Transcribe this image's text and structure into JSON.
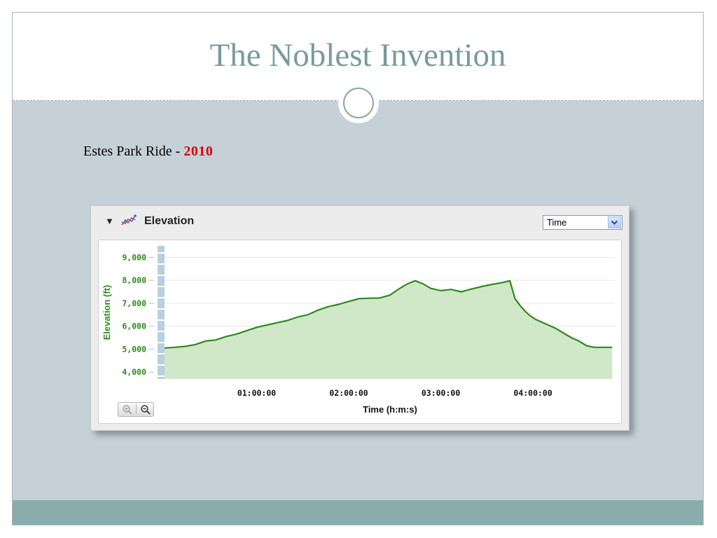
{
  "slide": {
    "title": "The Noblest Invention",
    "subtitle_prefix": "Estes Park Ride - ",
    "subtitle_year": "2010"
  },
  "widget": {
    "title": "Elevation",
    "select_value": "Time",
    "icons": [
      "collapse-triangle-icon",
      "elevation-chart-icon",
      "dropdown-chevron-icon",
      "zoom-in-icon",
      "zoom-out-icon"
    ]
  },
  "colors": {
    "title": "#7a9a9c",
    "slide_body": "#c5d1d7",
    "footer": "#8aacac",
    "year": "#d9000d",
    "line": "#2e8b1e",
    "fill": "#d0e8c7",
    "axis_text": "#2e8b1e"
  },
  "chart_data": {
    "type": "area",
    "xlabel": "Time (h:m:s)",
    "ylabel": "Elevation (ft)",
    "xlim": [
      0,
      17600
    ],
    "ylim": [
      3700,
      9500
    ],
    "y_ticks": [
      4000,
      5000,
      6000,
      7000,
      8000,
      9000
    ],
    "y_tick_labels": [
      "4,000",
      "5,000",
      "6,000",
      "7,000",
      "8,000",
      "9,000"
    ],
    "x_ticks": [
      3600,
      7200,
      10800,
      14400
    ],
    "x_tick_labels": [
      "01:00:00",
      "02:00:00",
      "03:00:00",
      "04:00:00"
    ],
    "grid": "horizontal",
    "series": [
      {
        "x": [
          0,
          400,
          800,
          1200,
          1600,
          2000,
          2400,
          2800,
          3200,
          3600,
          4000,
          4400,
          4800,
          5200,
          5600,
          6000,
          6400,
          6800,
          7200,
          7600,
          8000,
          8400,
          8800,
          9000,
          9200,
          9500,
          9800,
          10100,
          10400,
          10800,
          11200,
          11600,
          12000,
          12400,
          12800,
          13200,
          13500,
          13700,
          13900,
          14100,
          14300,
          14500,
          14700,
          15000,
          15300,
          15600,
          15900,
          16200,
          16500,
          16800,
          17100,
          17500
        ],
        "y": [
          5050,
          5080,
          5120,
          5200,
          5350,
          5400,
          5550,
          5650,
          5800,
          5950,
          6050,
          6150,
          6250,
          6400,
          6500,
          6700,
          6850,
          6950,
          7080,
          7200,
          7220,
          7230,
          7350,
          7500,
          7650,
          7850,
          7980,
          7850,
          7650,
          7550,
          7600,
          7500,
          7620,
          7730,
          7820,
          7900,
          7980,
          7200,
          6900,
          6650,
          6450,
          6300,
          6200,
          6050,
          5900,
          5700,
          5500,
          5350,
          5150,
          5080,
          5080,
          5080
        ]
      }
    ]
  }
}
